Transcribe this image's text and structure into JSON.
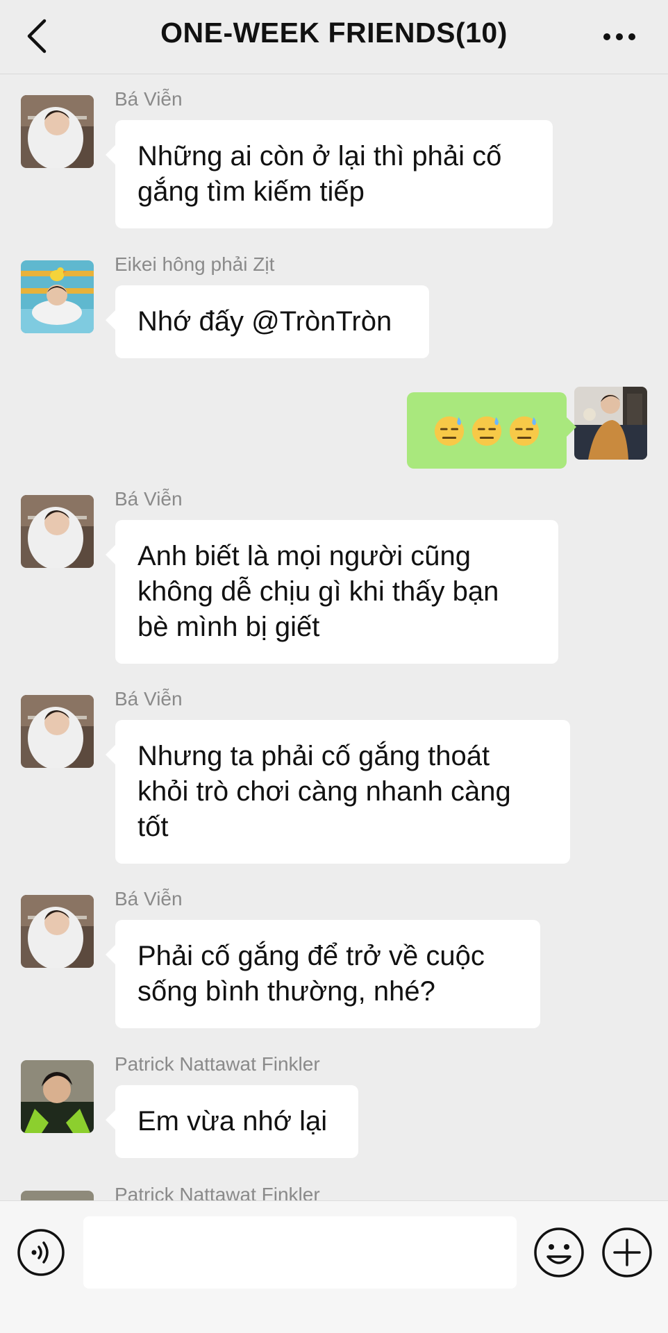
{
  "header": {
    "title": "ONE-WEEK FRIENDS(10)",
    "back_icon": "chevron-left-icon",
    "more_icon": "more-dots-icon"
  },
  "messages": [
    {
      "sender": "Bá Viễn",
      "text_lines": [
        "Những ai còn ở lại thì phải cố",
        "gắng tìm kiếm tiếp"
      ]
    },
    {
      "sender": "Eikei hông phải Zịt",
      "text_lines": [
        "Nhớ đấy @TrònTròn"
      ]
    },
    {
      "sender": "",
      "mine": true,
      "emojis": [
        "😓",
        "😓",
        "😓"
      ]
    },
    {
      "sender": "Bá Viễn",
      "text_lines": [
        "Anh biết là mọi người cũng",
        "không dễ chịu gì khi thấy bạn",
        "bè mình bị giết"
      ]
    },
    {
      "sender": "Bá Viễn",
      "text_lines": [
        "Nhưng ta phải cố gắng thoát",
        "khỏi trò chơi càng nhanh càng",
        "tốt"
      ]
    },
    {
      "sender": "Bá Viễn",
      "text_lines": [
        "Phải cố gắng để trở về cuộc",
        "sống bình thường, nhé?"
      ]
    },
    {
      "sender": "Patrick Nattawat Finkler",
      "text_lines": [
        "Em vừa nhớ lại"
      ]
    },
    {
      "sender": "Patrick Nattawat Finkler",
      "text_lines": []
    }
  ],
  "input_bar": {
    "placeholder": "",
    "voice_icon": "voice-icon",
    "emoji_icon": "smiley-icon",
    "plus_icon": "plus-circle-icon"
  },
  "colors": {
    "background": "#ededed",
    "bubble_other": "#ffffff",
    "bubble_mine": "#a9e87d",
    "sender_text": "#8a8a8a"
  }
}
